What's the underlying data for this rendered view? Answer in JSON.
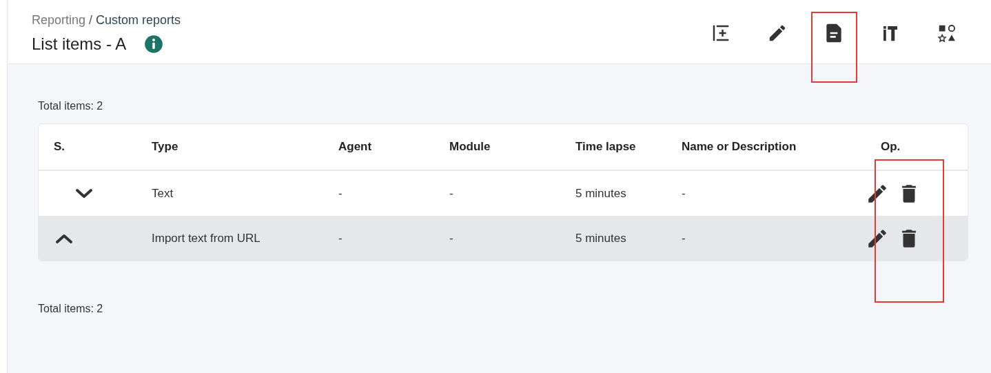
{
  "breadcrumb": {
    "parent": "Reporting",
    "separator": "/",
    "current": "Custom reports"
  },
  "title": "List items - A",
  "toolbar": [
    {
      "kind": "add",
      "selected": false
    },
    {
      "kind": "edit",
      "selected": false
    },
    {
      "kind": "document",
      "selected": true
    },
    {
      "kind": "tools",
      "selected": false
    },
    {
      "kind": "shapes",
      "selected": false
    }
  ],
  "total_top": "Total items: 2",
  "table": {
    "columns": [
      "S.",
      "Type",
      "Agent",
      "Module",
      "Time lapse",
      "Name or Description",
      "Op."
    ],
    "rows": [
      {
        "expanded": false,
        "selected": false,
        "type": "Text",
        "agent": "-",
        "module": "-",
        "time_lapse": "5 minutes",
        "name_or_description": "-"
      },
      {
        "expanded": true,
        "selected": true,
        "type": "Import text from URL",
        "agent": "-",
        "module": "-",
        "time_lapse": "5 minutes",
        "name_or_description": "-"
      }
    ]
  },
  "total_bottom": "Total items: 2"
}
